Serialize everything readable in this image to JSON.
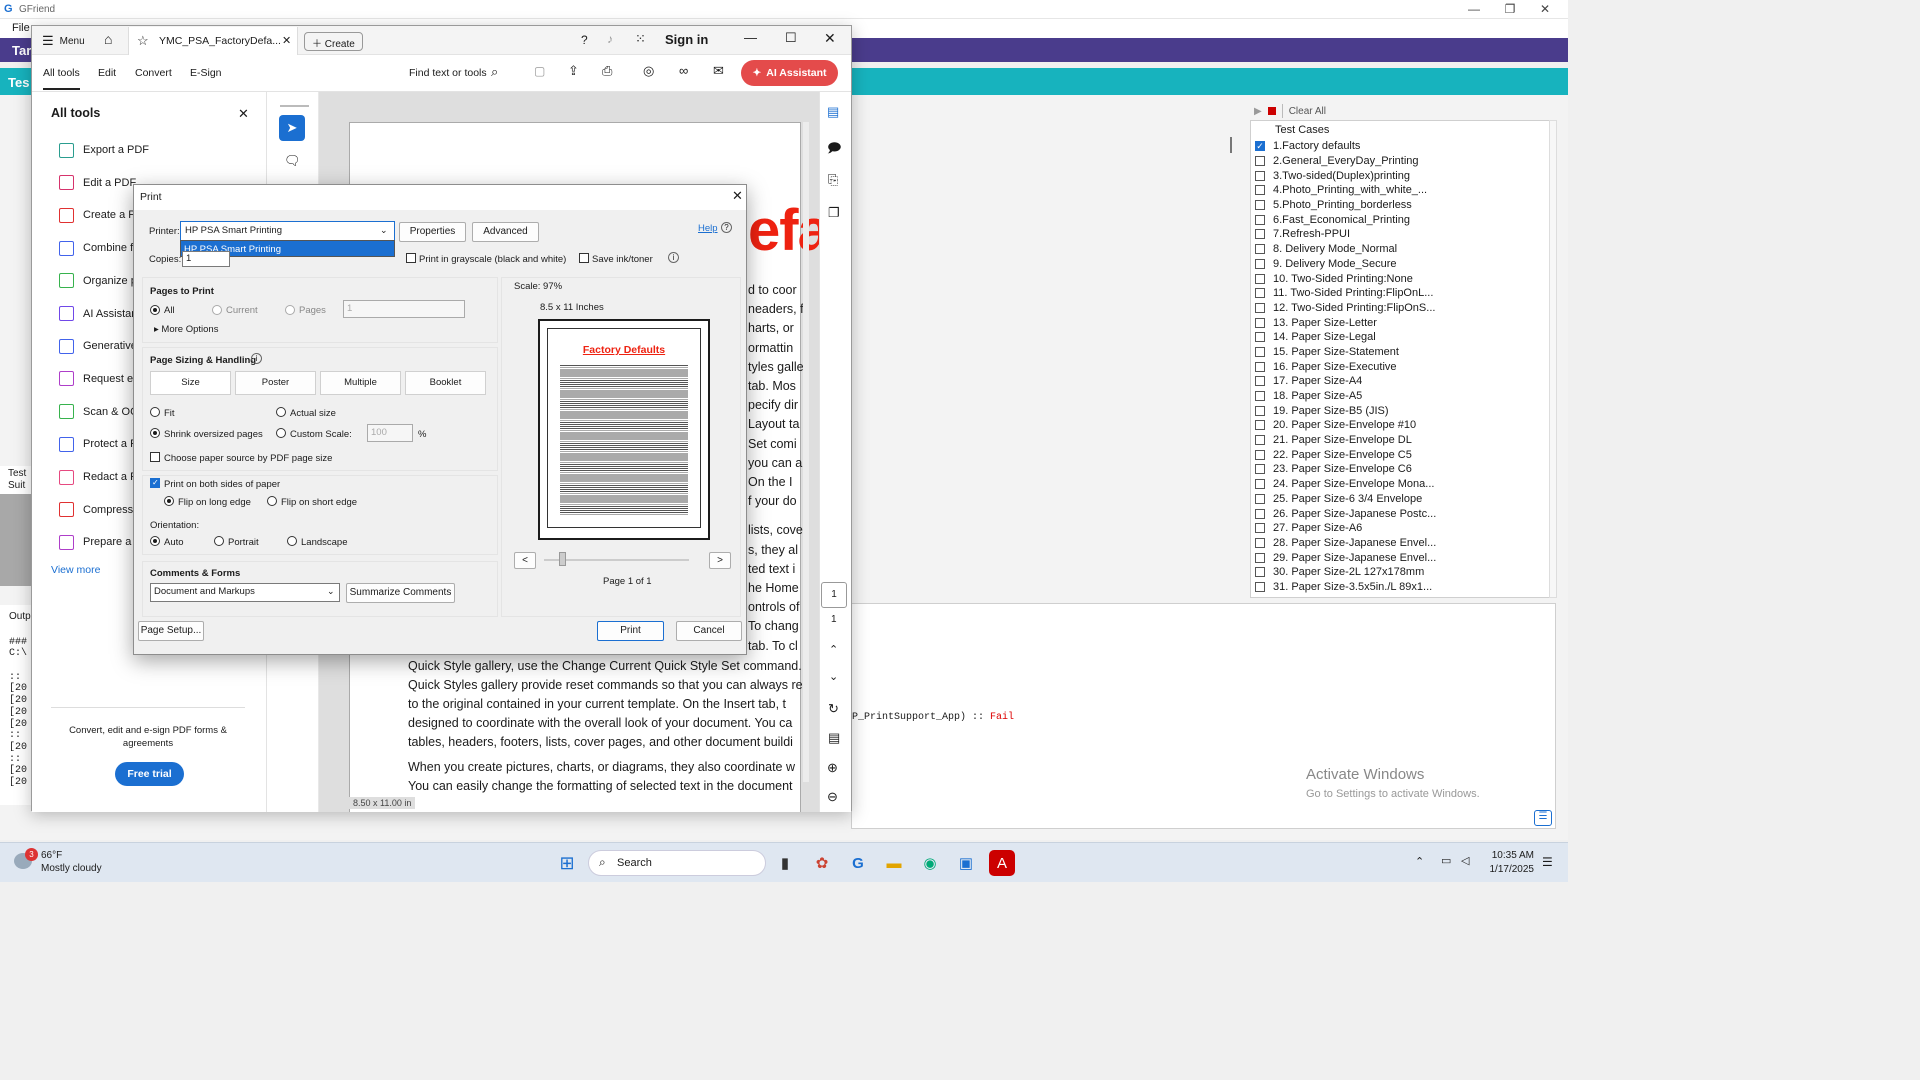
{
  "bg_app": {
    "title": "GFriend",
    "menu_file": "File",
    "purple_label": "Tar",
    "teal_label": "Tes",
    "clear_all": "Clear All",
    "test_suite": "Test Suit",
    "output": "Outp",
    "output_lines": [
      "###",
      "C:\\",
      "",
      "::",
      "[20",
      "[20",
      "[20",
      "[20",
      "::",
      "[20",
      "::",
      "[20",
      "[20"
    ],
    "result_text": "P_PrintSupport_App) :: ",
    "result_fail": "Fail",
    "activate_title": "Activate Windows",
    "activate_sub": "Go to Settings to activate Windows."
  },
  "test_cases": {
    "header": "Test Cases",
    "items": [
      {
        "label": "1.Factory defaults",
        "checked": true
      },
      {
        "label": "2.General_EveryDay_Printing",
        "checked": false
      },
      {
        "label": "3.Two-sided(Duplex)printing",
        "checked": false
      },
      {
        "label": "4.Photo_Printing_with_white_...",
        "checked": false
      },
      {
        "label": "5.Photo_Printing_borderless",
        "checked": false
      },
      {
        "label": "6.Fast_Economical_Printing",
        "checked": false
      },
      {
        "label": "7.Refresh-PPUI",
        "checked": false
      },
      {
        "label": "8. Delivery Mode_Normal",
        "checked": false
      },
      {
        "label": "9. Delivery Mode_Secure",
        "checked": false
      },
      {
        "label": "10. Two-Sided Printing:None",
        "checked": false
      },
      {
        "label": "11. Two-Sided Printing:FlipOnL...",
        "checked": false
      },
      {
        "label": "12. Two-Sided Printing:FlipOnS...",
        "checked": false
      },
      {
        "label": "13. Paper Size-Letter",
        "checked": false
      },
      {
        "label": "14. Paper Size-Legal",
        "checked": false
      },
      {
        "label": "15. Paper Size-Statement",
        "checked": false
      },
      {
        "label": "16. Paper Size-Executive",
        "checked": false
      },
      {
        "label": "17. Paper Size-A4",
        "checked": false
      },
      {
        "label": "18. Paper Size-A5",
        "checked": false
      },
      {
        "label": "19. Paper Size-B5 (JIS)",
        "checked": false
      },
      {
        "label": "20. Paper Size-Envelope #10",
        "checked": false
      },
      {
        "label": "21. Paper Size-Envelope DL",
        "checked": false
      },
      {
        "label": "22. Paper Size-Envelope C5",
        "checked": false
      },
      {
        "label": "23. Paper Size-Envelope C6",
        "checked": false
      },
      {
        "label": "24. Paper Size-Envelope Mona...",
        "checked": false
      },
      {
        "label": "25. Paper Size-6 3/4 Envelope",
        "checked": false
      },
      {
        "label": "26. Paper Size-Japanese Postc...",
        "checked": false
      },
      {
        "label": "27. Paper Size-A6",
        "checked": false
      },
      {
        "label": "28. Paper Size-Japanese Envel...",
        "checked": false
      },
      {
        "label": "29. Paper Size-Japanese Envel...",
        "checked": false
      },
      {
        "label": "30. Paper Size-2L 127x178mm",
        "checked": false
      },
      {
        "label": "31. Paper Size-3.5x5in./L 89x1...",
        "checked": false
      }
    ]
  },
  "acrobat": {
    "menu": "Menu",
    "tab_title": "YMC_PSA_FactoryDefa...",
    "create": "Create",
    "sign_in": "Sign in",
    "nav": [
      "All tools",
      "Edit",
      "Convert",
      "E-Sign"
    ],
    "find": "Find text or tools",
    "ai_assistant": "AI Assistant",
    "alltools_title": "All tools",
    "tools": [
      {
        "label": "Export a PDF",
        "color": "#2a9d8f"
      },
      {
        "label": "Edit a PDF",
        "color": "#d6336c"
      },
      {
        "label": "Create a PI",
        "color": "#e03131"
      },
      {
        "label": "Combine fi",
        "color": "#4263eb"
      },
      {
        "label": "Organize p",
        "color": "#37b24d"
      },
      {
        "label": "AI Assistant",
        "color": "#7048e8"
      },
      {
        "label": "Generative",
        "color": "#4263eb"
      },
      {
        "label": "Request e-",
        "color": "#ae3ec9"
      },
      {
        "label": "Scan & OC",
        "color": "#37b24d"
      },
      {
        "label": "Protect a P",
        "color": "#4263eb"
      },
      {
        "label": "Redact a P",
        "color": "#e64980"
      },
      {
        "label": "Compress a",
        "color": "#e03131"
      },
      {
        "label": "Prepare a f",
        "color": "#ae3ec9"
      }
    ],
    "view_more": "View more",
    "promo": "Convert, edit and e-sign PDF forms & agreements",
    "free_trial": "Free trial",
    "page_size": "8.50 x 11.00 in",
    "page_num": "1",
    "page_total": "1",
    "doc_heading": "efa",
    "doc_right_fragments": [
      "d to coor",
      "neaders, f",
      "harts, or",
      "ormattin",
      "tyles galle",
      "tab. Mos",
      "pecify dir",
      "Layout ta",
      "Set comi",
      "you can a",
      "On the I",
      "f your do",
      "lists, cove",
      "s, they al",
      "ted text i",
      "he Home",
      "ontrols of",
      "To chang",
      "tab. To cl"
    ],
    "doc_lines": [
      "Quick Style gallery, use the Change Current Quick Style Set command.",
      "Quick Styles gallery provide reset commands so that you can always re",
      "to the original contained in your current template. On the Insert tab, t",
      "designed to coordinate with the overall look of your document. You ca",
      "tables, headers, footers, lists, cover pages, and other document buildi",
      "",
      "When you create pictures, charts, or diagrams, they also coordinate w",
      "You can easily change the formatting of selected text in the document"
    ]
  },
  "print": {
    "title": "Print",
    "printer_label": "Printer:",
    "printer_value": "HP PSA Smart Printing",
    "dropdown_option": "HP PSA Smart Printing",
    "properties": "Properties",
    "advanced": "Advanced",
    "help": "Help",
    "copies_label": "Copies:",
    "copies_value": "1",
    "grayscale": "Print in grayscale (black and white)",
    "save_ink": "Save ink/toner",
    "pages_to_print": "Pages to Print",
    "all": "All",
    "current": "Current",
    "pages": "Pages",
    "pages_value": "1",
    "more_options": "More Options",
    "sizing": "Page Sizing & Handling",
    "size": "Size",
    "poster": "Poster",
    "multiple": "Multiple",
    "booklet": "Booklet",
    "fit": "Fit",
    "actual_size": "Actual size",
    "shrink": "Shrink oversized pages",
    "custom_scale": "Custom Scale:",
    "custom_value": "100",
    "percent": "%",
    "paper_source": "Choose paper source by PDF page size",
    "both_sides": "Print on both sides of paper",
    "flip_long": "Flip on long edge",
    "flip_short": "Flip on short edge",
    "orientation": "Orientation:",
    "auto": "Auto",
    "portrait": "Portrait",
    "landscape": "Landscape",
    "comments_forms": "Comments & Forms",
    "comments_value": "Document and Markups",
    "summarize": "Summarize Comments",
    "scale": "Scale:  97%",
    "paper": "8.5 x 11 Inches",
    "preview_title": "Factory Defaults",
    "page_of": "Page 1 of 1",
    "page_setup": "Page Setup...",
    "print_btn": "Print",
    "cancel": "Cancel"
  },
  "taskbar": {
    "weather_temp": "66°F",
    "weather_desc": "Mostly cloudy",
    "weather_badge": "3",
    "search": "Search",
    "time": "10:35 AM",
    "date": "1/17/2025"
  }
}
